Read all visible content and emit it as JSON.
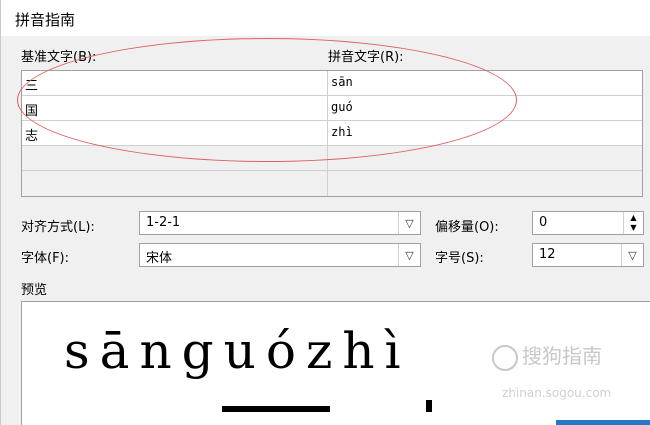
{
  "dialog": {
    "title": "拼音指南"
  },
  "grid": {
    "base_header": "基准文字(B):",
    "ruby_header": "拼音文字(R):",
    "rows": [
      {
        "base": "三",
        "ruby": "sān"
      },
      {
        "base": "国",
        "ruby": "guó"
      },
      {
        "base": "志",
        "ruby": "zhì"
      },
      {
        "base": "",
        "ruby": ""
      },
      {
        "base": "",
        "ruby": ""
      }
    ]
  },
  "alignment": {
    "label": "对齐方式(L):",
    "value": "1-2-1"
  },
  "offset": {
    "label": "偏移量(O):",
    "value": "0"
  },
  "font": {
    "label": "字体(F):",
    "value": "宋体"
  },
  "size": {
    "label": "字号(S):",
    "value": "12"
  },
  "preview": {
    "label": "预览",
    "text": "sānguózhì",
    "watermark": "搜狗指南",
    "watermark_url": "zhinan.sogou.com"
  },
  "colors": {
    "annotation": "#e06060",
    "accent": "#2a76c6"
  }
}
